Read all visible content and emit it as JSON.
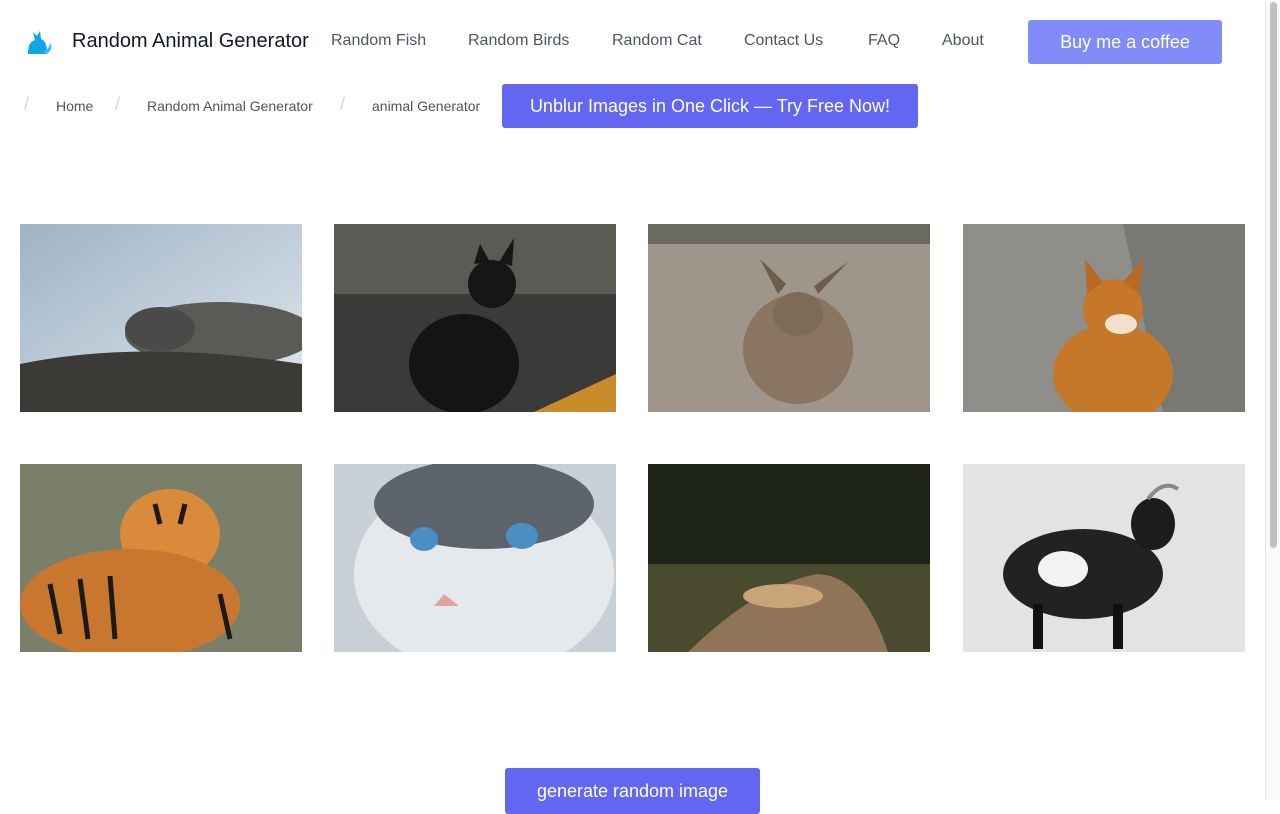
{
  "header": {
    "logo_icon": "cat-logo-icon",
    "site_title": "Random Animal Generator",
    "nav": [
      {
        "label": "Random Fish"
      },
      {
        "label": "Random Birds"
      },
      {
        "label": "Random Cat"
      },
      {
        "label": "Contact Us"
      },
      {
        "label": "FAQ"
      },
      {
        "label": "About"
      }
    ],
    "coffee_button": "Buy me a coffee"
  },
  "breadcrumb": {
    "items": [
      "Home",
      "Random Animal Generator",
      "animal Generator"
    ]
  },
  "promo_button": "Unblur Images in One Click — Try Free Now!",
  "gallery": {
    "images": [
      {
        "subject": "seal"
      },
      {
        "subject": "black-cat"
      },
      {
        "subject": "deer"
      },
      {
        "subject": "shiba-dog"
      },
      {
        "subject": "tigers"
      },
      {
        "subject": "blue-eyed-kitten"
      },
      {
        "subject": "lioness"
      },
      {
        "subject": "goat"
      }
    ]
  },
  "generate_button": "generate random image",
  "colors": {
    "primary": "#6366f1",
    "primary_light": "#818cf8"
  }
}
